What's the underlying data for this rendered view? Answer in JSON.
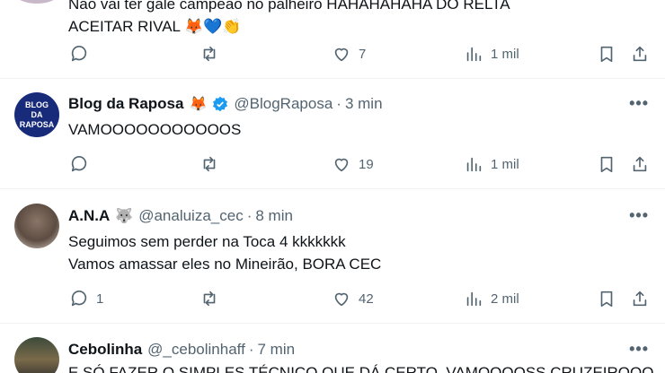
{
  "tweets": [
    {
      "text_lines": [
        "Não vai ter gale campeão no palheiro HAHAHAHAHA DO RELTA",
        "ACEITAR RIVAL 🦊💙👏"
      ],
      "stats": {
        "replies": "",
        "retweets": "",
        "likes": "7",
        "views": "1 mil"
      }
    },
    {
      "name": "Blog da Raposa",
      "name_emoji": "🦊",
      "verified": true,
      "handle": "@BlogRaposa",
      "time": "3 min",
      "avatar_text": "BLOG DA RAPOSA",
      "text_lines": [
        "VAMOOOOOOOOOOOS"
      ],
      "stats": {
        "replies": "",
        "retweets": "",
        "likes": "19",
        "views": "1 mil"
      }
    },
    {
      "name": "A.N.A",
      "name_emoji": "🐺",
      "handle": "@analuiza_cec",
      "time": "8 min",
      "text_lines": [
        "Seguimos sem perder na Toca 4 kkkkkkk",
        "Vamos amassar eles no Mineirão, BORA CEC"
      ],
      "stats": {
        "replies": "1",
        "retweets": "",
        "likes": "42",
        "views": "2 mil"
      }
    },
    {
      "name": "Cebolinha",
      "handle": "@_cebolinhaff",
      "time": "7 min",
      "text_lines": [
        "E SÓ FAZER O SIMPLES TÉCNICO QUE DÁ CERTO. VAMOOOOSS CRUZEIROOO"
      ]
    }
  ],
  "separator": "·",
  "more_glyph": "•••",
  "colors": {
    "text": "#0f1419",
    "muted": "#536471",
    "verified": "#1d9bf0",
    "border": "#eff3f4"
  }
}
